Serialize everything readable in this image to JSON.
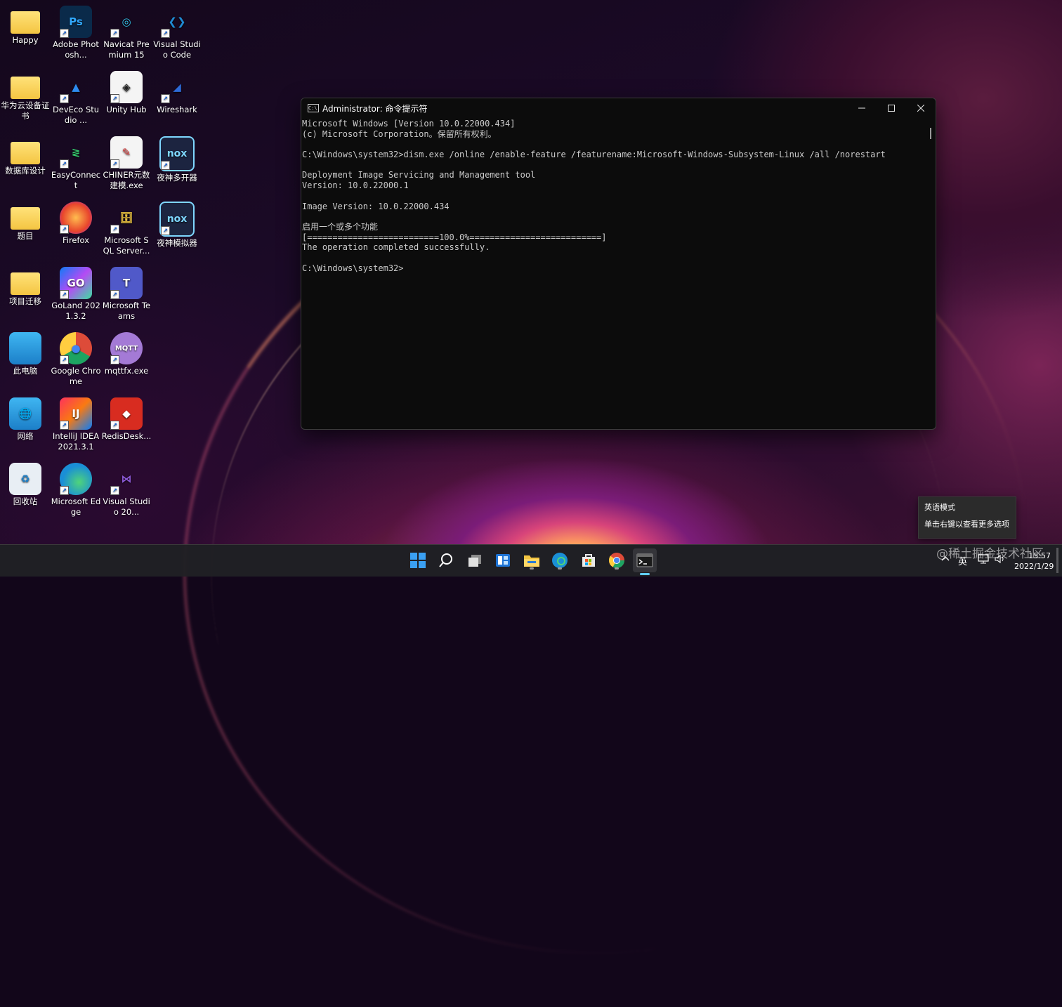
{
  "desktop": {
    "icons": [
      {
        "label": "Happy",
        "icon": "folder-icon"
      },
      {
        "label": "Adobe Photosh...",
        "icon": "photoshop-icon"
      },
      {
        "label": "Navicat Premium 15",
        "icon": "navicat-icon"
      },
      {
        "label": "Visual Studio Code",
        "icon": "vscode-icon"
      },
      {
        "label": "华为云设备证书",
        "icon": "folder-icon"
      },
      {
        "label": "DevEco Studio ...",
        "icon": "deveco-icon"
      },
      {
        "label": "Unity Hub",
        "icon": "unity-icon"
      },
      {
        "label": "Wireshark",
        "icon": "wireshark-icon"
      },
      {
        "label": "数据库设计",
        "icon": "folder-icon"
      },
      {
        "label": "EasyConnect",
        "icon": "easyconnect-icon"
      },
      {
        "label": "CHINER元数建模.exe",
        "icon": "chiner-icon"
      },
      {
        "label": "夜神多开器",
        "icon": "nox-icon"
      },
      {
        "label": "题目",
        "icon": "folder-icon"
      },
      {
        "label": "Firefox",
        "icon": "firefox-icon"
      },
      {
        "label": "Microsoft SQL Server...",
        "icon": "sqlserver-icon"
      },
      {
        "label": "夜神模拟器",
        "icon": "nox-icon"
      },
      {
        "label": "项目迁移",
        "icon": "folder-icon"
      },
      {
        "label": "GoLand 2021.3.2",
        "icon": "goland-icon"
      },
      {
        "label": "Microsoft Teams",
        "icon": "teams-icon"
      },
      {
        "label": "此电脑",
        "icon": "computer-icon"
      },
      {
        "label": "Google Chrome",
        "icon": "chrome-icon"
      },
      {
        "label": "mqttfx.exe",
        "icon": "mqttfx-icon"
      },
      {
        "label": "网络",
        "icon": "network-icon"
      },
      {
        "label": "IntelliJ IDEA 2021.3.1",
        "icon": "intellij-icon"
      },
      {
        "label": "RedisDesk...",
        "icon": "redis-icon"
      },
      {
        "label": "回收站",
        "icon": "recycle-bin-icon"
      },
      {
        "label": "Microsoft Edge",
        "icon": "edge-icon"
      },
      {
        "label": "Visual Studio 20...",
        "icon": "visual-studio-icon"
      }
    ]
  },
  "cmd": {
    "title": "Administrator: 命令提示符",
    "lines": [
      "Microsoft Windows [Version 10.0.22000.434]",
      "(c) Microsoft Corporation。保留所有权利。",
      "",
      "C:\\Windows\\system32>dism.exe /online /enable-feature /featurename:Microsoft-Windows-Subsystem-Linux /all /norestart",
      "",
      "Deployment Image Servicing and Management tool",
      "Version: 10.0.22000.1",
      "",
      "Image Version: 10.0.22000.434",
      "",
      "启用一个或多个功能",
      "[==========================100.0%==========================]",
      "The operation completed successfully.",
      "",
      "C:\\Windows\\system32>"
    ]
  },
  "ime_tooltip": {
    "line1": "英语模式",
    "line2": "单击右键以查看更多选项"
  },
  "taskbar": {
    "apps": [
      "start-icon",
      "search-icon",
      "task-view-icon",
      "widgets-icon",
      "file-explorer-icon",
      "edge-icon",
      "store-icon",
      "chrome-icon",
      "terminal-icon"
    ],
    "tray": {
      "lang": "英",
      "time": "15:57",
      "date": "2022/1/29"
    }
  },
  "watermark": "@稀土掘金技术社区",
  "colors": {
    "cmd_bg": "#0c0c0c",
    "cmd_text": "#cccccc",
    "taskbar_bg": "#202024",
    "accent": "#60cdff"
  }
}
